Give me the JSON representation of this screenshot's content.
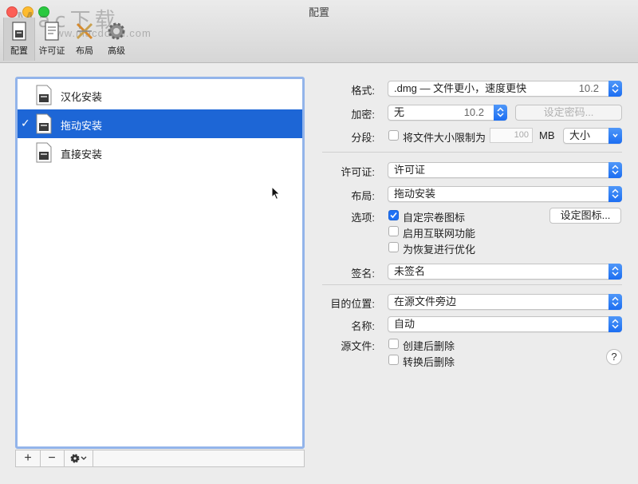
{
  "window": {
    "title": "配置",
    "watermark": "Mac下载",
    "watermark_url": "www.macdown.com"
  },
  "toolbar": {
    "items": [
      {
        "label": "配置",
        "icon": "config-icon",
        "active": true
      },
      {
        "label": "许可证",
        "icon": "license-icon",
        "active": false
      },
      {
        "label": "布局",
        "icon": "layout-icon",
        "active": false
      },
      {
        "label": "高级",
        "icon": "gear-icon",
        "active": false
      }
    ]
  },
  "list": {
    "items": [
      {
        "label": "汉化安装",
        "selected": false
      },
      {
        "label": "拖动安装",
        "selected": true
      },
      {
        "label": "直接安装",
        "selected": false
      }
    ],
    "check_glyph": "✓",
    "footer": {
      "add": "+",
      "remove": "−"
    }
  },
  "form": {
    "format": {
      "label": "格式:",
      "value": ".dmg — 文件更小，速度更快",
      "version": "10.2"
    },
    "encryption": {
      "label": "加密:",
      "value": "无",
      "version": "10.2",
      "button": "设定密码..."
    },
    "segment": {
      "label": "分段:",
      "checkbox": "将文件大小限制为",
      "size": "100",
      "unit": "MB",
      "size_popup": "大小"
    },
    "license": {
      "label": "许可证:",
      "value": "许可证"
    },
    "layout": {
      "label": "布局:",
      "value": "拖动安装"
    },
    "options": {
      "label": "选项:",
      "items": [
        {
          "label": "自定宗卷图标",
          "checked": true
        },
        {
          "label": "启用互联网功能",
          "checked": false
        },
        {
          "label": "为恢复进行优化",
          "checked": false
        }
      ],
      "icon_button": "设定图标..."
    },
    "signature": {
      "label": "签名:",
      "value": "未签名"
    },
    "destination": {
      "label": "目的位置:",
      "value": "在源文件旁边"
    },
    "name": {
      "label": "名称:",
      "value": "自动"
    },
    "source": {
      "label": "源文件:",
      "items": [
        {
          "label": "创建后删除",
          "checked": false
        },
        {
          "label": "转换后删除",
          "checked": false
        }
      ]
    },
    "help": "?"
  }
}
